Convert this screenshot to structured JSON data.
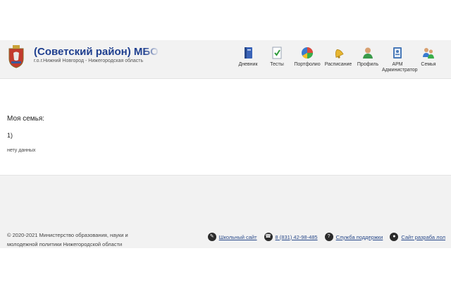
{
  "header": {
    "title": "(Советский район) МБОУ \"Шк",
    "subtitle": "г.о.г.Нижний Новгород - Нижегородская область",
    "nav": [
      {
        "label": "Дневник",
        "icon": "diary-book-icon"
      },
      {
        "label": "Тесты",
        "icon": "test-checklist-icon"
      },
      {
        "label": "Портфолио",
        "icon": "portfolio-pie-icon"
      },
      {
        "label": "Расписание",
        "icon": "schedule-bell-icon"
      },
      {
        "label": "Профиль",
        "icon": "profile-user-icon"
      },
      {
        "label": "АРМ Администратор",
        "icon": "admin-contacts-icon"
      },
      {
        "label": "Семья",
        "icon": "family-users-icon"
      }
    ]
  },
  "content": {
    "family_title": "Моя семья:",
    "family_number": "1)",
    "family_empty": "нету данных"
  },
  "footer": {
    "copyright": "© 2020-2021 Министерство образования, науки и молодежной политики Нижегородской области",
    "links": [
      {
        "label": "Школьный сайт",
        "icon": "school-site-icon"
      },
      {
        "label": "8 (831) 42-98-485",
        "icon": "phone-icon"
      },
      {
        "label": "Служба поддержки",
        "icon": "support-help-icon"
      },
      {
        "label": "Сайт разраба лол",
        "icon": "developer-user-icon"
      }
    ]
  },
  "colors": {
    "header_bg": "#f2f2f2",
    "title": "#1f3f8f",
    "link": "#2a4a8a"
  }
}
